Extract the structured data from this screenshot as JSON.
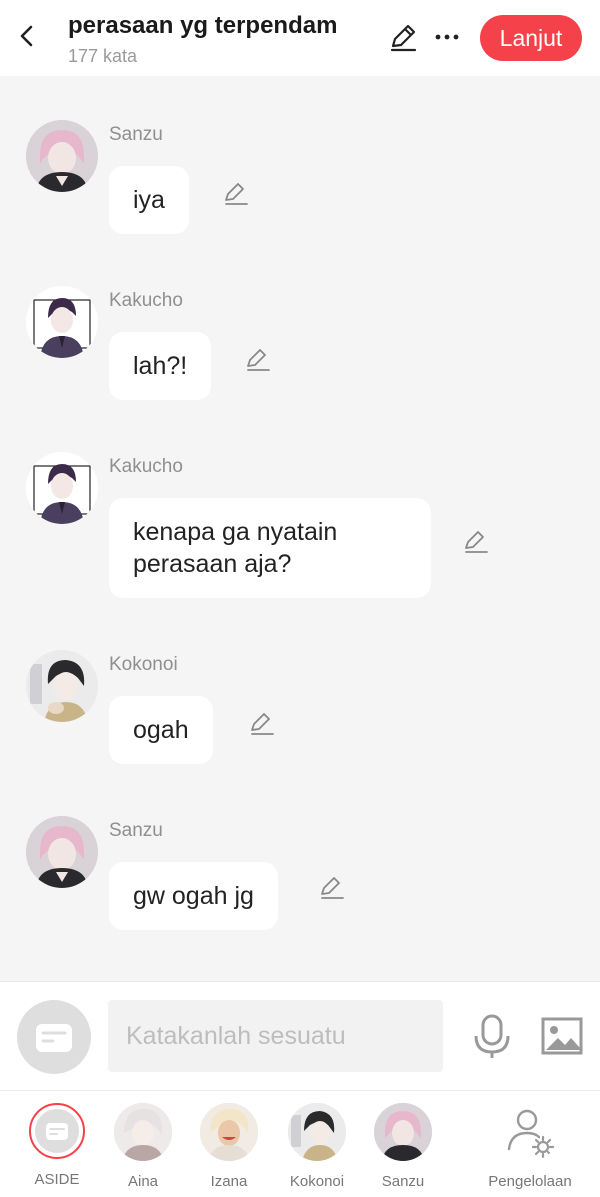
{
  "header": {
    "title": "perasaan yg terpendam",
    "subtitle": "177 kata",
    "next_label": "Lanjut",
    "accent": "#f5424a"
  },
  "messages": [
    {
      "name": "Sanzu",
      "text": "iya"
    },
    {
      "name": "Kakucho",
      "text": "lah?!"
    },
    {
      "name": "Kakucho",
      "text": "kenapa ga nyatain perasaan aja?"
    },
    {
      "name": "Kokonoi",
      "text": "ogah"
    },
    {
      "name": "Sanzu",
      "text": "gw ogah jg"
    }
  ],
  "composer": {
    "placeholder": "Katakanlah sesuatu",
    "value": ""
  },
  "characters": [
    {
      "label": "ASIDE",
      "selected": true
    },
    {
      "label": "Aina"
    },
    {
      "label": "Izana"
    },
    {
      "label": "Kokonoi"
    },
    {
      "label": "Sanzu"
    },
    {
      "label": "Pengelolaan"
    }
  ],
  "icons": {
    "back": "chevron-left-icon",
    "edit": "pencil-icon",
    "more": "more-horizontal-icon",
    "mic": "microphone-icon",
    "image": "image-icon",
    "manage": "user-settings-icon"
  }
}
